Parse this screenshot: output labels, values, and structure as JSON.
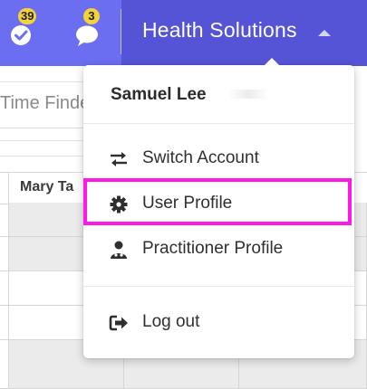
{
  "topbar": {
    "tasks_badge": "39",
    "messages_badge": "3",
    "org_name": "Health Solutions",
    "tasks_icon": "check-circle-icon",
    "messages_icon": "chat-bubble-icon"
  },
  "background": {
    "search_placeholder": "Time Finde",
    "column_header": "Mary Ta"
  },
  "dropdown": {
    "user_name": "Samuel Lee",
    "items": [
      {
        "label": "Switch Account",
        "icon": "switch-arrows-icon"
      },
      {
        "label": "User Profile",
        "icon": "gear-icon"
      },
      {
        "label": "Practitioner Profile",
        "icon": "user-medical-icon"
      },
      {
        "label": "Log out",
        "icon": "sign-out-icon"
      }
    ]
  },
  "colors": {
    "topbar": "#6b6ef1",
    "brand_area": "#5654d6",
    "badge": "#f3d23a",
    "highlight": "#ff19e6"
  }
}
